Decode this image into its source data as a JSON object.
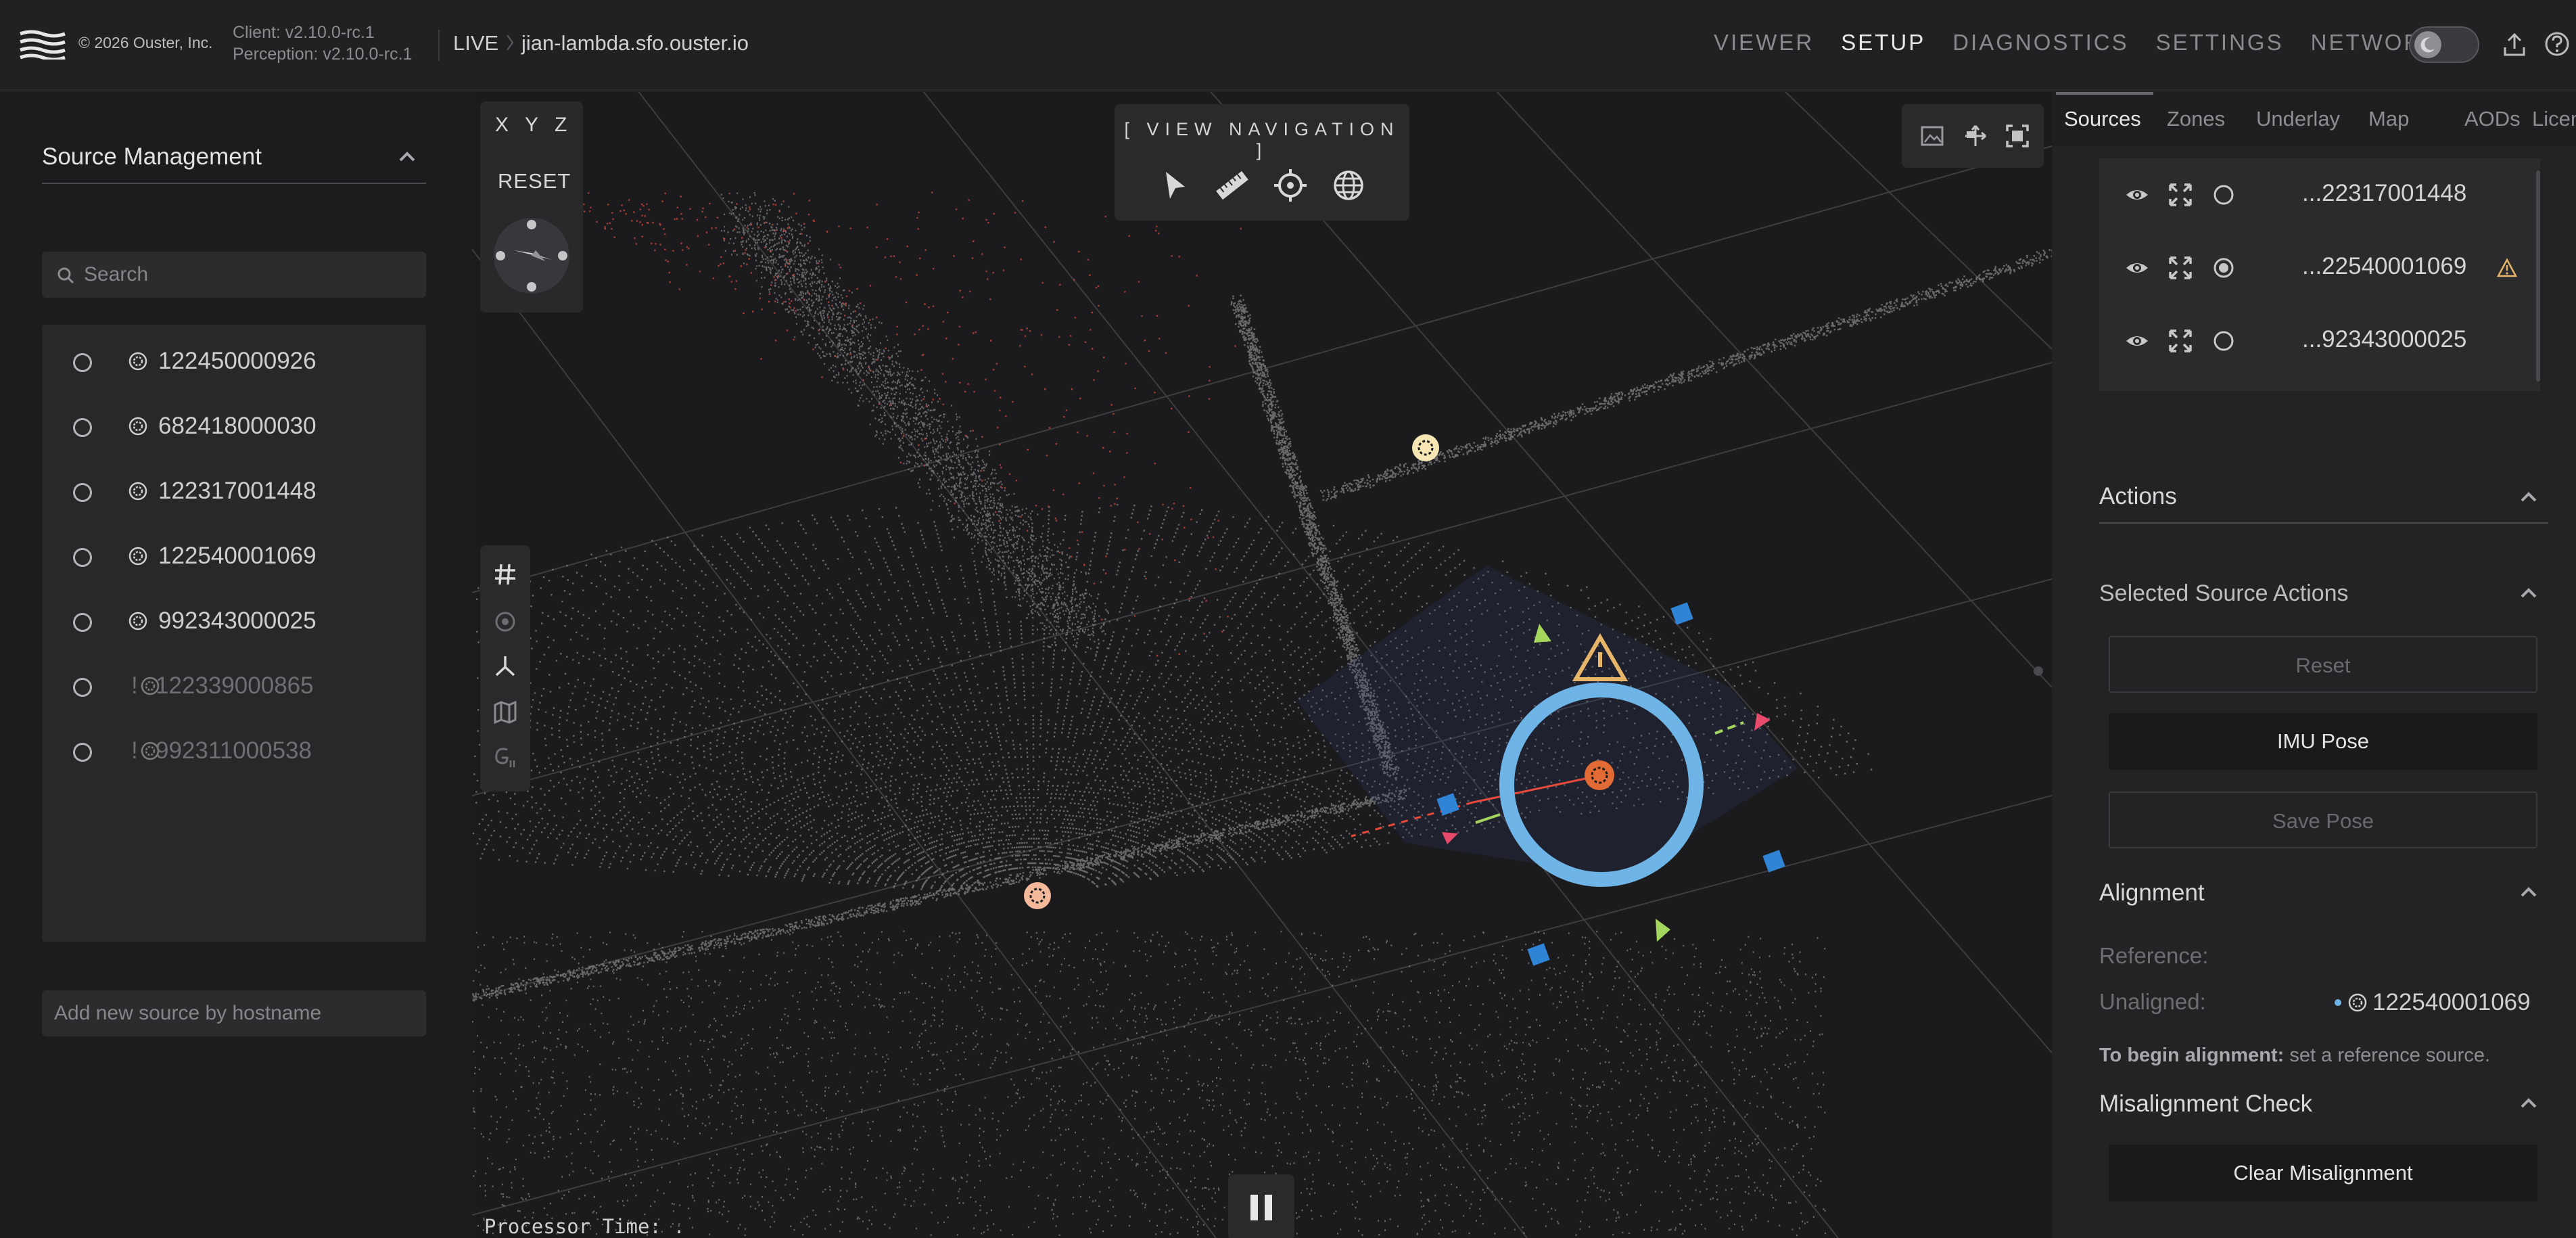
{
  "header": {
    "copyright": "© 2026 Ouster, Inc.",
    "client_version": "Client: v2.10.0-rc.1",
    "perception_version": "Perception: v2.10.0-rc.1",
    "mode": "LIVE",
    "hostname": "jian-lambda.sfo.ouster.io",
    "nav": [
      "VIEWER",
      "SETUP",
      "DIAGNOSTICS",
      "SETTINGS",
      "NETWORK"
    ],
    "active_nav": "SETUP"
  },
  "source_management": {
    "title": "Source Management",
    "search_placeholder": "Search",
    "add_placeholder": "Add new source by hostname",
    "sources": [
      {
        "id": "122450000926",
        "offline": false
      },
      {
        "id": "682418000030",
        "offline": false
      },
      {
        "id": "122317001448",
        "offline": false
      },
      {
        "id": "122540001069",
        "offline": false
      },
      {
        "id": "992343000025",
        "offline": false
      },
      {
        "id": "122339000865",
        "offline": true
      },
      {
        "id": "992311000538",
        "offline": true
      }
    ],
    "offline_prefix": "!"
  },
  "viewer": {
    "axes": [
      "X",
      "Y",
      "Z"
    ],
    "reset_label": "RESET",
    "view_navigation_label": "[ VIEW NAVIGATION ]",
    "processor_time_label": "Processor Time:  ."
  },
  "right_panel": {
    "tabs": [
      "Sources",
      "Zones",
      "Underlay",
      "Map",
      "AODs",
      "License"
    ],
    "active_tab": "Sources",
    "sensor_rows": [
      {
        "name": "...22317001448",
        "selected": false,
        "warning": false
      },
      {
        "name": "...22540001069",
        "selected": true,
        "warning": true
      },
      {
        "name": "...92343000025",
        "selected": false,
        "warning": false
      }
    ],
    "actions_title": "Actions",
    "selected_source_actions_title": "Selected Source Actions",
    "reset_button": "Reset",
    "imu_pose_button": "IMU Pose",
    "save_pose_button": "Save Pose",
    "alignment_title": "Alignment",
    "reference_label": "Reference:",
    "unaligned_label": "Unaligned:",
    "unaligned_value": "122540001069",
    "alignment_hint_bold": "To begin alignment:",
    "alignment_hint_rest": " set a reference source.",
    "misalignment_title": "Misalignment Check",
    "clear_misalignment_button": "Clear Misalignment"
  },
  "colors": {
    "accent_blue": "#6fb4e6",
    "warning_amber": "#e7b56a",
    "marker_orange": "#e26a35",
    "point_gray": "#8a8a8e",
    "point_red": "#c4453f"
  }
}
